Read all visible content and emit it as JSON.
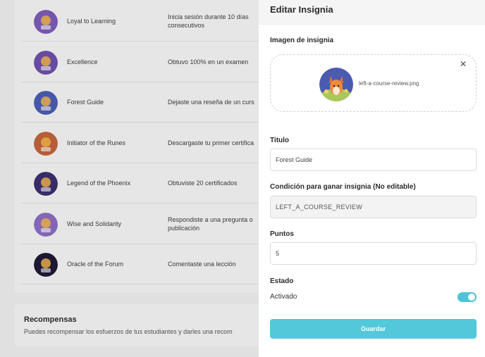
{
  "background": {
    "badges": [
      {
        "name": "Loyal to Learning",
        "condition": "Inicia sesión durante 10 días consecutivos",
        "icon": "book-badge-icon",
        "color": "#7a5ab5"
      },
      {
        "name": "Excellence",
        "condition": "Obtuvo 100% en un examen",
        "icon": "trophy-badge-icon",
        "color": "#6c4ea8"
      },
      {
        "name": "Forest Guide",
        "condition": "Dejaste una reseña de un curs",
        "icon": "fox-badge-icon",
        "color": "#4a5bb0"
      },
      {
        "name": "Initiator of the Runes",
        "condition": "Descargaste tu primer certifica",
        "icon": "rune-badge-icon",
        "color": "#c0623a"
      },
      {
        "name": "Legend of the Phoenix",
        "condition": "Obtuviste 20 certificados",
        "icon": "phoenix-badge-icon",
        "color": "#3a2d6b"
      },
      {
        "name": "Wise and Solidarity",
        "condition": "Respondiste a una pregunta o publicación",
        "icon": "owl-badge-icon",
        "color": "#8a6bc0"
      },
      {
        "name": "Oracle of the Forum",
        "condition": "Comentaste una lección",
        "icon": "oracle-badge-icon",
        "color": "#1e1836"
      }
    ],
    "rewards": {
      "title": "Recompensas",
      "subtitle": "Puedes recompensar los esfuerzos de tus estudiantes y darles una recom"
    }
  },
  "drawer": {
    "title": "Editar Insignia",
    "image_label": "Imagen de insignia",
    "image_filename": "left-a-course-review.png",
    "close_icon": "close-icon",
    "title_label": "Titulo",
    "title_value": "Forest Guide",
    "condition_label": "Condición para ganar insignia (No editable)",
    "condition_value": "LEFT_A_COURSE_REVIEW",
    "points_label": "Puntos",
    "points_value": "5",
    "status_label": "Estado",
    "status_text": "Activado",
    "status_on": true,
    "save_label": "Guardar",
    "accent_color": "#52c8da"
  }
}
